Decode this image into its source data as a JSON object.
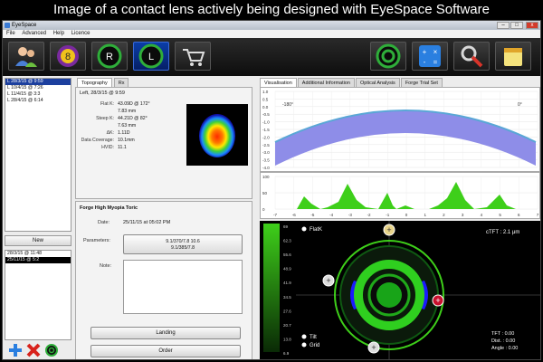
{
  "caption": "Image of a contact lens actively being designed with EyeSpace Software",
  "window": {
    "title": "EyeSpace",
    "controls": [
      "–",
      "□",
      "x"
    ]
  },
  "menu": [
    "File",
    "Advanced",
    "Help",
    "Licence"
  ],
  "toolbar": [
    {
      "name": "patients-icon",
      "glyph": ""
    },
    {
      "name": "lens-8-icon",
      "glyph": "8"
    },
    {
      "name": "right-eye-icon",
      "glyph": "R"
    },
    {
      "name": "left-eye-icon",
      "glyph": "L"
    },
    {
      "name": "cart-icon",
      "glyph": ""
    },
    {
      "name": "lens-ring-icon",
      "glyph": ""
    },
    {
      "name": "calculator-icon",
      "glyph": ""
    },
    {
      "name": "tools-icon",
      "glyph": ""
    },
    {
      "name": "notes-icon",
      "glyph": ""
    }
  ],
  "sessions": [
    {
      "text": "L 28/3/15 @ 9:59",
      "selected": true
    },
    {
      "text": "L 10/4/15 @ 7:26",
      "selected": false
    },
    {
      "text": "L 11/4/15 @ 3:3",
      "selected": false
    },
    {
      "text": "L 28/4/15 @ 6:14",
      "selected": false
    }
  ],
  "new_button": "New",
  "orders": [
    {
      "text": "28/3/15 @ 11:48",
      "selected": false
    },
    {
      "text": "25/11/15 @ 5:2",
      "selected": true
    }
  ],
  "mid_tabs": [
    "Topography",
    "Rx"
  ],
  "topo": {
    "header": "Left, 28/3/15 @ 9:59",
    "rows": [
      {
        "k": "Flat K:",
        "v": "43.09D @ 172°"
      },
      {
        "k": "",
        "v": "7.83 mm"
      },
      {
        "k": "Steep K:",
        "v": "44.21D @ 82°"
      },
      {
        "k": "",
        "v": "7.63 mm"
      },
      {
        "k": "ΔK:",
        "v": "1.11D"
      },
      {
        "k": "Data Coverage:",
        "v": "10.1mm"
      },
      {
        "k": "HVID:",
        "v": "11.1"
      }
    ]
  },
  "forge": {
    "title": "Forge High Myopia Toric",
    "date_label": "Date:",
    "date_value": "25/11/15  at  05:02 PM",
    "params_label": "Parameters:",
    "params_line1": "9.1/370/7.8 10.6",
    "params_line2": "9.1/385/7.8",
    "note_label": "Note:",
    "landing_button": "Landing",
    "order_button": "Order"
  },
  "right_tabs": [
    "Visualisation",
    "Additional Information",
    "Optical Analysis",
    "Forge Trial Set"
  ],
  "plot1": {
    "yticks": [
      "1.0",
      "0.5",
      "0.0",
      "-0.5",
      "-1.0",
      "-1.5",
      "-2.0",
      "-2.5",
      "-3.0",
      "-3.5",
      "-4.0"
    ],
    "left_label": "-180°",
    "right_label": "0°"
  },
  "plot2": {
    "yticks": [
      "100",
      "50",
      "0"
    ],
    "xticks": [
      "-7",
      "-6",
      "-5",
      "-4",
      "-3",
      "-2",
      "-1",
      "0",
      "1",
      "2",
      "3",
      "4",
      "5",
      "6",
      "7"
    ]
  },
  "viz": {
    "scale": [
      "69",
      "62.3",
      "55.6",
      "48.9",
      "41.9",
      "34.5",
      "27.6",
      "20.7",
      "13.8",
      "6.9"
    ],
    "flatk_label": "FlatK",
    "tilt_label": "Tilt",
    "grid_label": "Grid",
    "ctft": "cTFT : 2.1 μm",
    "tft": "TFT : 0.00",
    "dist": "Dist. : 0.00",
    "angle": "Angle : 0.00"
  },
  "colors": {
    "band": "#8e8de8",
    "profile": "#5aa7d6",
    "green": "#3ecf1a",
    "ring": "#26b14a",
    "blue": "#1a1aff",
    "active_blue": "#0b3ea8",
    "selection": "#1c3f9e"
  }
}
